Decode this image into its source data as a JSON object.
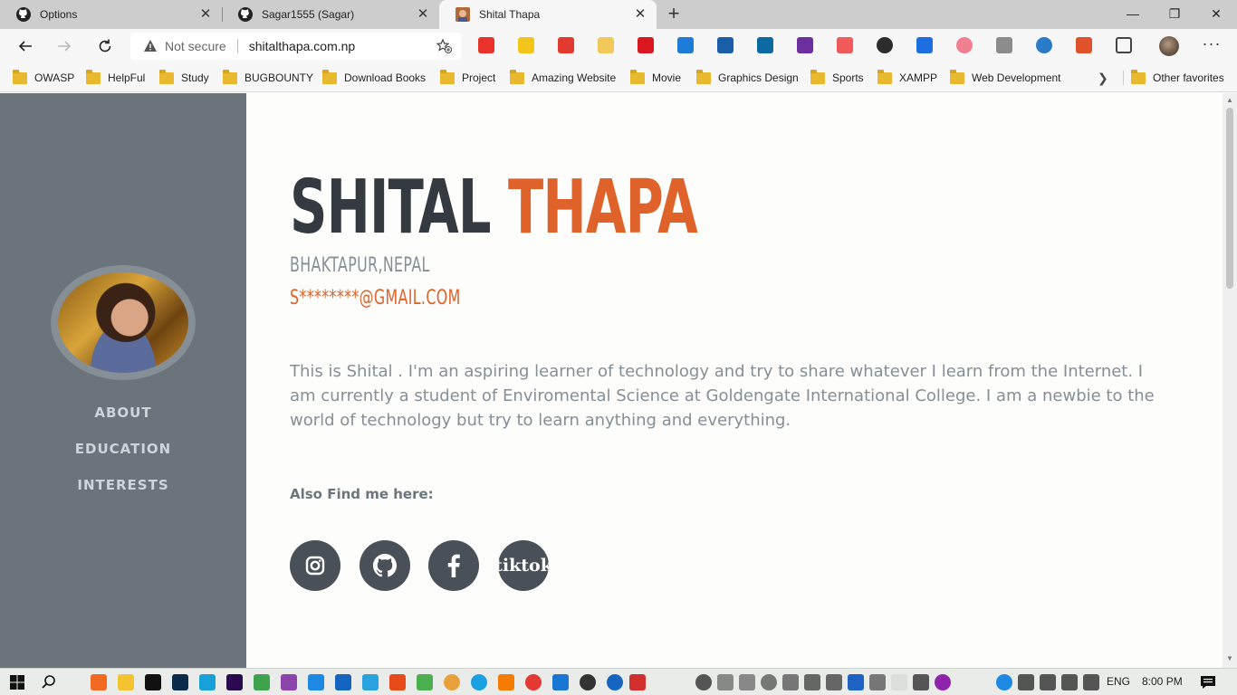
{
  "browser": {
    "tabs": [
      {
        "title": "Options",
        "active": false
      },
      {
        "title": "Sagar1555 (Sagar)",
        "active": false
      },
      {
        "title": "Shital Thapa",
        "active": true
      }
    ],
    "address": {
      "security_label": "Not secure",
      "url": "shitalthapa.com.np"
    },
    "bookmarks": [
      "OWASP",
      "HelpFul",
      "Study",
      "BUGBOUNTY",
      "Download Books",
      "Project",
      "Amazing Website",
      "Movie",
      "Graphics Design",
      "Sports",
      "XAMPP",
      "Web Development"
    ],
    "other_bookmarks": "Other favorites"
  },
  "page": {
    "first_name": "SHITAL",
    "last_name": "THAPA",
    "location": "BHAKTAPUR,NEPAL",
    "email": "S********@GMAIL.COM",
    "bio": "This is Shital . I'm an aspiring learner of technology and try to share whatever I learn from the Internet. I am currently a student of Enviromental Science at Goldengate International College. I am a newbie to the world of technology but try to learn anything and everything.",
    "social_heading": "Also Find me here:",
    "social": [
      {
        "name": "instagram",
        "label": ""
      },
      {
        "name": "github",
        "label": ""
      },
      {
        "name": "facebook",
        "label": ""
      },
      {
        "name": "tiktok",
        "label": "tiktok"
      }
    ],
    "nav": [
      "ABOUT",
      "EDUCATION",
      "INTERESTS"
    ]
  },
  "taskbar": {
    "language": "ENG",
    "time": "8:00 PM"
  },
  "colors": {
    "sidebar": "#6b737b",
    "accent": "#e0622b",
    "dark": "#343a40",
    "muted": "#868e96"
  }
}
